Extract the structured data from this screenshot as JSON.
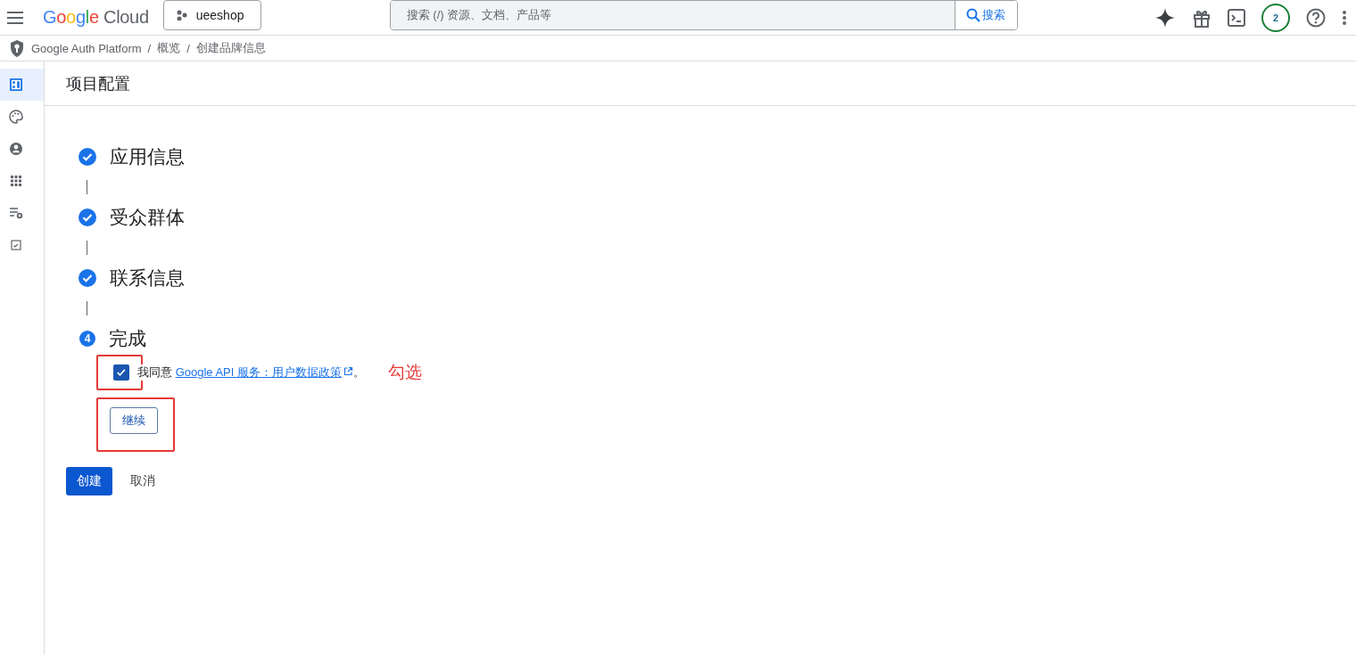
{
  "topbar": {
    "brand": "Google Cloud",
    "project": "ueeshop",
    "search": {
      "placeholder": "搜索 (/) 资源、文档、产品等",
      "button": "搜索"
    },
    "notification_count": "2"
  },
  "breadcrumb": {
    "items": [
      "Google Auth Platform",
      "概览",
      "创建品牌信息"
    ],
    "separator": "/"
  },
  "sidebar": {
    "items": [
      {
        "selected": true
      },
      {
        "selected": false
      },
      {
        "selected": false
      },
      {
        "selected": false
      },
      {
        "selected": false
      },
      {
        "selected": false
      }
    ]
  },
  "page_title": "项目配置",
  "steps": [
    {
      "label": "应用信息",
      "done": true
    },
    {
      "label": "受众群体",
      "done": true
    },
    {
      "label": "联系信息",
      "done": true
    },
    {
      "label": "完成",
      "done": false,
      "number": "4"
    }
  ],
  "agreement": {
    "checked": true,
    "prefix": "我同意",
    "link": "Google API 服务：用户数据政策",
    "suffix": "。"
  },
  "continue_button": "继续",
  "annotation": "勾选",
  "actions": {
    "primary": "创建",
    "secondary": "取消"
  }
}
